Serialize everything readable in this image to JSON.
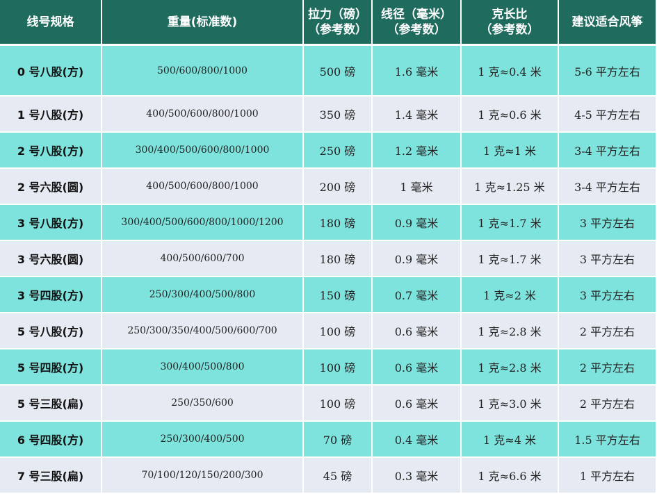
{
  "header": {
    "spec": "线号规格",
    "weight": "重量(标准数)",
    "tension": [
      "拉力（磅）",
      "（参考数）"
    ],
    "diameter": [
      "线径（毫米）",
      "（参考数）"
    ],
    "ratio": [
      "克长比",
      "（参考数）"
    ],
    "kite": "建议适合风筝"
  },
  "rows": [
    {
      "spec": "0 号八股(方)",
      "weight": "500/600/800/1000",
      "tension": "500 磅",
      "diameter": "1.6 毫米",
      "ratio": "1 克≈0.4 米",
      "kite": "5-6 平方左右"
    },
    {
      "spec": "1 号八股(方)",
      "weight": "400/500/600/800/1000",
      "tension": "350 磅",
      "diameter": "1.4 毫米",
      "ratio": "1 克≈0.6 米",
      "kite": "4-5 平方左右"
    },
    {
      "spec": "2 号八股(方)",
      "weight": "300/400/500/600/800/1000",
      "tension": "250 磅",
      "diameter": "1.2 毫米",
      "ratio": "1 克≈1 米",
      "kite": "3-4 平方左右"
    },
    {
      "spec": "2 号六股(圆)",
      "weight": "400/500/600/800/1000",
      "tension": "200 磅",
      "diameter": "1 毫米",
      "ratio": "1 克≈1.25 米",
      "kite": "3-4 平方左右"
    },
    {
      "spec": "3 号八股(方)",
      "weight": "300/400/500/600/800/1000/1200",
      "tension": "180 磅",
      "diameter": "0.9 毫米",
      "ratio": "1 克≈1.7 米",
      "kite": "3 平方左右"
    },
    {
      "spec": "3 号六股(圆)",
      "weight": "400/500/600/700",
      "tension": "180 磅",
      "diameter": "0.9 毫米",
      "ratio": "1 克≈1.7 米",
      "kite": "3 平方左右"
    },
    {
      "spec": "3 号四股(方)",
      "weight": "250/300/400/500/800",
      "tension": "150 磅",
      "diameter": "0.7 毫米",
      "ratio": "1 克≈2 米",
      "kite": "3 平方左右"
    },
    {
      "spec": "5 号八股(方)",
      "weight": "250/300/350/400/500/600/700",
      "tension": "100 磅",
      "diameter": "0.6 毫米",
      "ratio": "1 克≈2.8 米",
      "kite": "2 平方左右"
    },
    {
      "spec": "5 号四股(方)",
      "weight": "300/400/500/800",
      "tension": "100 磅",
      "diameter": "0.6 毫米",
      "ratio": "1 克≈2.8 米",
      "kite": "2 平方左右"
    },
    {
      "spec": "5 号三股(扁)",
      "weight": "250/350/600",
      "tension": "100 磅",
      "diameter": "0.6 毫米",
      "ratio": "1 克≈3.0 米",
      "kite": "2 平方左右"
    },
    {
      "spec": "6 号四股(方)",
      "weight": "250/300/400/500",
      "tension": "70 磅",
      "diameter": "0.4 毫米",
      "ratio": "1 克≈4 米",
      "kite": "1.5 平方左右"
    },
    {
      "spec": "7 号三股(扁)",
      "weight": "70/100/120/150/200/300",
      "tension": "45 磅",
      "diameter": "0.3 毫米",
      "ratio": "1 克≈6.6 米",
      "kite": "1 平方左右"
    }
  ],
  "colors": {
    "header": "#1f6b5e",
    "row_teal": "#7fe3dd",
    "row_gray": "#e6eaf2"
  }
}
